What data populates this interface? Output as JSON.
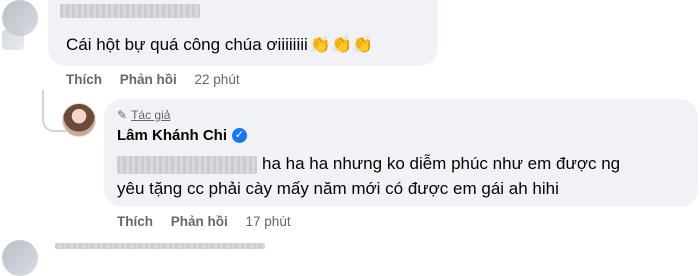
{
  "comment1": {
    "text": "Cái hột bự quá công chúa ơiiiiiiii",
    "emoji": "👏👏👏",
    "actions": {
      "like": "Thích",
      "reply": "Phản hồi",
      "time": "22 phút"
    }
  },
  "reply": {
    "author_badge": "Tác giả",
    "author_name": "Lâm Khánh Chi",
    "line1_visible": "ha ha ha nhưng ko diễm phúc như em được ng",
    "line2": "yêu tặng cc phải cày mấy năm mới có được em gái ah hihi",
    "actions": {
      "like": "Thích",
      "reply": "Phản hồi",
      "time": "17 phút"
    }
  },
  "colors": {
    "bubble": "#f0f2f5",
    "meta": "#65676b",
    "verified": "#1877f2"
  }
}
